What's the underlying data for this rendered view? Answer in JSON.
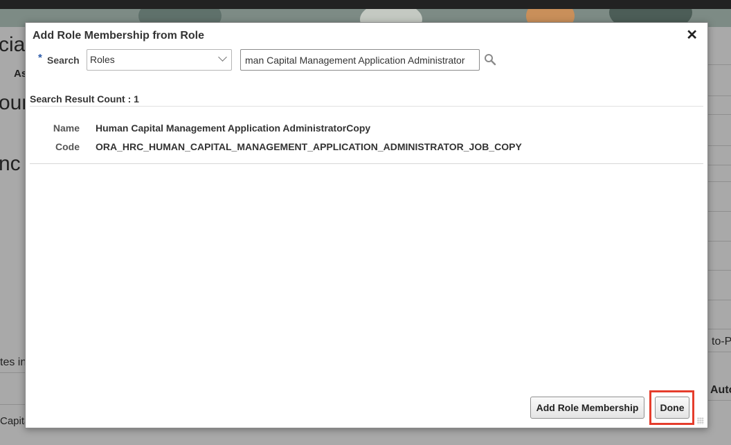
{
  "background": {
    "fragments": [
      "cia",
      "As",
      "oun",
      "nc",
      "tes in",
      "Capita",
      "to-P",
      "Auto"
    ]
  },
  "dialog": {
    "title": "Add Role Membership from Role",
    "search": {
      "label": "Search",
      "required_mark": "*",
      "type_value": "Roles",
      "query_value": "man Capital Management Application Administrator"
    },
    "result_count_text": "Search Result Count : 1",
    "result": {
      "name_label": "Name",
      "name_value": "Human Capital Management Application AdministratorCopy",
      "code_label": "Code",
      "code_value": "ORA_HRC_HUMAN_CAPITAL_MANAGEMENT_APPLICATION_ADMINISTRATOR_JOB_COPY"
    },
    "buttons": {
      "add_role_membership": "Add Role Membership",
      "done": "Done"
    }
  },
  "colors": {
    "highlight": "#e53d2c",
    "required_star": "#2b5aa8"
  }
}
